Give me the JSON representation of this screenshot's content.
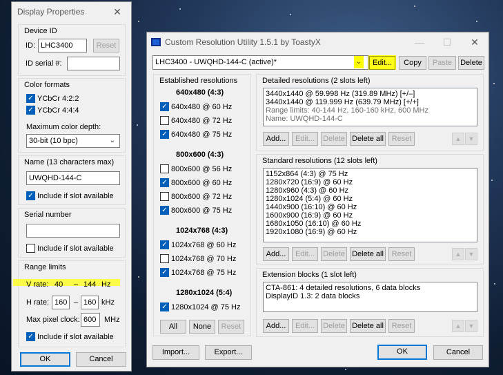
{
  "display_properties": {
    "title": "Display Properties",
    "close_glyph": "✕",
    "device_id": {
      "group_title": "Device ID",
      "id_label": "ID:",
      "id_value": "LHC3400",
      "reset_label": "Reset",
      "serial_label": "ID serial #:",
      "serial_value": ""
    },
    "color_formats": {
      "group_title": "Color formats",
      "ycbcr422": "YCbCr 4:2:2",
      "ycbcr444": "YCbCr 4:4:4",
      "depth_label": "Maximum color depth:",
      "depth_value": "30-bit (10 bpc)"
    },
    "name": {
      "group_title": "Name (13 characters max)",
      "value": "UWQHD-144-C",
      "include_label": "Include if slot available"
    },
    "serial_number": {
      "group_title": "Serial number",
      "value": "",
      "include_label": "Include if slot available"
    },
    "range_limits": {
      "group_title": "Range limits",
      "vrate_label": "V rate:",
      "vrate_min": "40",
      "vrate_max": "144",
      "vrate_unit": "Hz",
      "hrate_label": "H rate:",
      "hrate_min": "160",
      "hrate_max": "160",
      "hrate_unit": "kHz",
      "pixel_clock_label": "Max pixel clock:",
      "pixel_clock_value": "600",
      "pixel_clock_unit": "MHz",
      "include_label": "Include if slot available",
      "dash": "–"
    },
    "ok_label": "OK",
    "cancel_label": "Cancel"
  },
  "cru": {
    "title": "Custom Resolution Utility 1.5.1 by ToastyX",
    "min_glyph": "—",
    "max_glyph": "☐",
    "close_glyph": "✕",
    "monitor_select": "LHC3400 - UWQHD-144-C (active)*",
    "edit_label": "Edit...",
    "copy_label": "Copy",
    "paste_label": "Paste",
    "delete_label": "Delete",
    "established": {
      "title": "Established resolutions",
      "groups": [
        {
          "header": "640x480 (4:3)",
          "items": [
            {
              "label": "640x480 @ 60 Hz",
              "checked": true
            },
            {
              "label": "640x480 @ 72 Hz",
              "checked": false
            },
            {
              "label": "640x480 @ 75 Hz",
              "checked": true
            }
          ]
        },
        {
          "header": "800x600 (4:3)",
          "items": [
            {
              "label": "800x600 @ 56 Hz",
              "checked": false
            },
            {
              "label": "800x600 @ 60 Hz",
              "checked": true
            },
            {
              "label": "800x600 @ 72 Hz",
              "checked": false
            },
            {
              "label": "800x600 @ 75 Hz",
              "checked": true
            }
          ]
        },
        {
          "header": "1024x768 (4:3)",
          "items": [
            {
              "label": "1024x768 @ 60 Hz",
              "checked": true
            },
            {
              "label": "1024x768 @ 70 Hz",
              "checked": false
            },
            {
              "label": "1024x768 @ 75 Hz",
              "checked": true
            }
          ]
        },
        {
          "header": "1280x1024 (5:4)",
          "items": [
            {
              "label": "1280x1024 @ 75 Hz",
              "checked": true
            }
          ]
        }
      ],
      "all_label": "All",
      "none_label": "None",
      "reset_label": "Reset"
    },
    "detailed": {
      "title": "Detailed resolutions (2 slots left)",
      "lines": [
        "3440x1440 @ 59.998 Hz (319.89 MHz) [+/–]",
        "3440x1440 @ 119.999 Hz (639.79 MHz) [+/+]",
        "Range limits: 40-144 Hz, 160-160 kHz, 600 MHz",
        "Name: UWQHD-144-C"
      ]
    },
    "standard": {
      "title": "Standard resolutions (12 slots left)",
      "lines": [
        "1152x864 (4:3) @ 75 Hz",
        "1280x720 (16:9) @ 60 Hz",
        "1280x960 (4:3) @ 60 Hz",
        "1280x1024 (5:4) @ 60 Hz",
        "1440x900 (16:10) @ 60 Hz",
        "1600x900 (16:9) @ 60 Hz",
        "1680x1050 (16:10) @ 60 Hz",
        "1920x1080 (16:9) @ 60 Hz"
      ]
    },
    "extension": {
      "title": "Extension blocks (1 slot left)",
      "lines": [
        "CTA-861: 4 detailed resolutions, 6 data blocks",
        "DisplayID 1.3: 2 data blocks"
      ]
    },
    "block_buttons": {
      "add": "Add...",
      "edit": "Edit...",
      "delete": "Delete",
      "delete_all": "Delete all",
      "reset": "Reset",
      "up": "▲",
      "down": "▼"
    },
    "import_label": "Import...",
    "export_label": "Export...",
    "ok_label": "OK",
    "cancel_label": "Cancel"
  }
}
